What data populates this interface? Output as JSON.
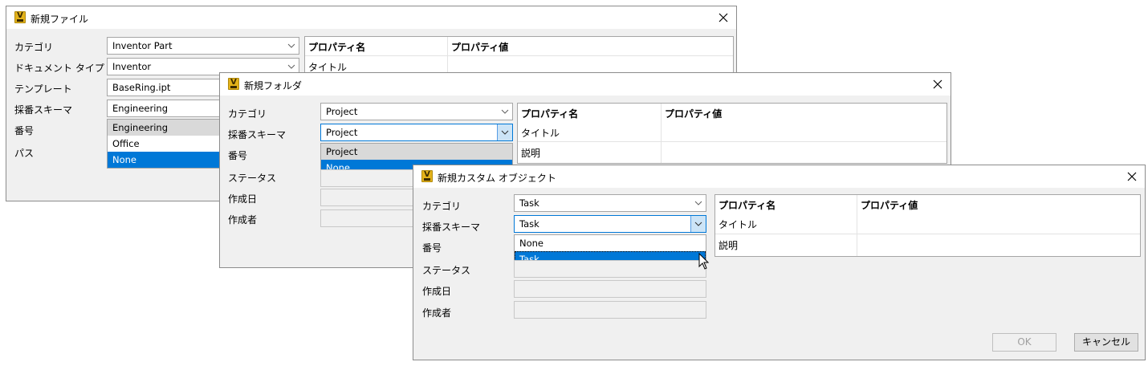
{
  "dialog1": {
    "title": "新規ファイル",
    "labels": {
      "category": "カテゴリ",
      "doc_type": "ドキュメント タイプ",
      "template": "テンプレート",
      "scheme": "採番スキーマ",
      "number": "番号",
      "path": "パス"
    },
    "category_value": "Inventor Part",
    "doc_type_value": "Inventor",
    "template_value": "BaseRing.ipt",
    "scheme_value": "Engineering",
    "scheme_options": [
      "Engineering",
      "Office",
      "None"
    ],
    "selected_option": "None",
    "grid": {
      "col1": "プロパティ名",
      "col2": "プロパティ値",
      "rows": [
        "タイトル"
      ]
    }
  },
  "dialog2": {
    "title": "新規フォルダ",
    "labels": {
      "category": "カテゴリ",
      "scheme": "採番スキーマ",
      "number": "番号",
      "status": "ステータス",
      "created": "作成日",
      "creator": "作成者"
    },
    "category_value": "Project",
    "scheme_value": "Project",
    "scheme_options": [
      "Project",
      "None"
    ],
    "selected_option": "None",
    "grid": {
      "col1": "プロパティ名",
      "col2": "プロパティ値",
      "rows": [
        "タイトル",
        "説明"
      ]
    }
  },
  "dialog3": {
    "title": "新規カスタム オブジェクト",
    "labels": {
      "category": "カテゴリ",
      "scheme": "採番スキーマ",
      "number": "番号",
      "status": "ステータス",
      "created": "作成日",
      "creator": "作成者"
    },
    "category_value": "Task",
    "scheme_value": "Task",
    "scheme_options": [
      "None",
      "Task"
    ],
    "selected_option": "Task",
    "grid": {
      "col1": "プロパティ名",
      "col2": "プロパティ値",
      "rows": [
        "タイトル",
        "説明"
      ]
    },
    "ok_label": "OK",
    "cancel_label": "キャンセル"
  },
  "icons": {
    "app": "vault-app-icon",
    "close": "close-icon",
    "dropdown": "chevron-down-icon",
    "cursor": "mouse-pointer-icon"
  },
  "colors": {
    "selection": "#0078d7",
    "dialog_bg": "#f0f0f0",
    "app_icon": "#e3b21a"
  }
}
